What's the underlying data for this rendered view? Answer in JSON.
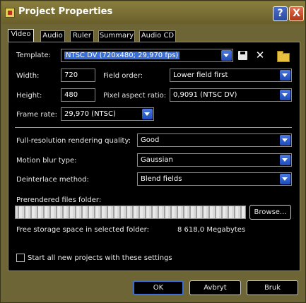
{
  "window": {
    "title": "Project Properties"
  },
  "titlebar": {
    "help_label": "?",
    "close_label": "X"
  },
  "tabs": [
    {
      "label": "Video"
    },
    {
      "label": "Audio"
    },
    {
      "label": "Ruler"
    },
    {
      "label": "Summary"
    },
    {
      "label": "Audio CD"
    }
  ],
  "video": {
    "template_label": "Template:",
    "template_value": "NTSC DV (720x480; 29,970 fps)",
    "width_label": "Width:",
    "width_value": "720",
    "height_label": "Height:",
    "height_value": "480",
    "field_order_label": "Field order:",
    "field_order_value": "Lower field first",
    "pixel_aspect_label": "Pixel aspect ratio:",
    "pixel_aspect_value": "0,9091 (NTSC DV)",
    "frame_rate_label": "Frame rate:",
    "frame_rate_value": "29,970 (NTSC)",
    "render_quality_label": "Full-resolution rendering quality:",
    "render_quality_value": "Good",
    "motion_blur_label": "Motion blur type:",
    "motion_blur_value": "Gaussian",
    "deinterlace_label": "Deinterlace method:",
    "deinterlace_value": "Blend fields",
    "prerender_label": "Prerendered files folder:",
    "browse_label": "Browse...",
    "storage_label": "Free storage space in selected folder:",
    "storage_value": "8 618,0 Megabytes",
    "start_all_label": "Start all new projects with these settings",
    "start_all_checked": false
  },
  "footer": {
    "ok_label": "OK",
    "cancel_label": "Avbryt",
    "apply_label": "Bruk"
  },
  "colors": {
    "frame": "#6e6536",
    "selection": "#3a6fd8",
    "dropdown_button": "#2c5ad0"
  },
  "icons": [
    "save-icon",
    "delete-icon",
    "folder-icon",
    "help-icon",
    "close-icon"
  ]
}
